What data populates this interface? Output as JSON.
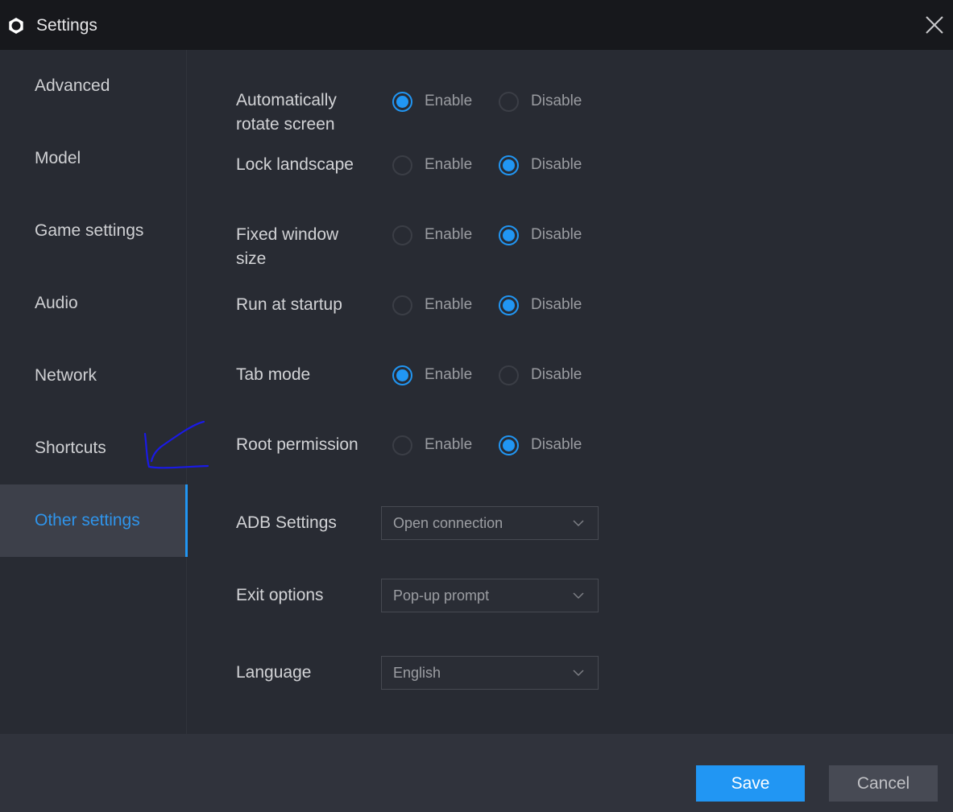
{
  "window": {
    "title": "Settings",
    "title_icon": "gear-icon",
    "close_icon": "close-icon"
  },
  "sidebar": {
    "items": [
      {
        "label": "Advanced",
        "active": false
      },
      {
        "label": "Model",
        "active": false
      },
      {
        "label": "Game settings",
        "active": false
      },
      {
        "label": "Audio",
        "active": false
      },
      {
        "label": "Network",
        "active": false
      },
      {
        "label": "Shortcuts",
        "active": false
      },
      {
        "label": "Other settings",
        "active": true
      }
    ]
  },
  "settings": {
    "radio_rows": [
      {
        "label": "Automatically rotate screen",
        "value": "Enable"
      },
      {
        "label": "Lock landscape",
        "value": "Disable"
      },
      {
        "label": "Fixed window size",
        "value": "Disable"
      },
      {
        "label": "Run at startup",
        "value": "Disable"
      },
      {
        "label": "Tab mode",
        "value": "Enable"
      },
      {
        "label": "Root permission",
        "value": "Disable"
      }
    ],
    "options": {
      "enable": "Enable",
      "disable": "Disable"
    },
    "dropdowns": [
      {
        "label": "ADB Settings",
        "value": "Open connection"
      },
      {
        "label": "Exit options",
        "value": "Pop-up prompt"
      },
      {
        "label": "Language",
        "value": "English"
      }
    ]
  },
  "footer": {
    "save_label": "Save",
    "cancel_label": "Cancel"
  },
  "colors": {
    "accent": "#2196f3",
    "titlebar": "#17181c",
    "background": "#282b33",
    "annotation": "#1a1ae6"
  }
}
